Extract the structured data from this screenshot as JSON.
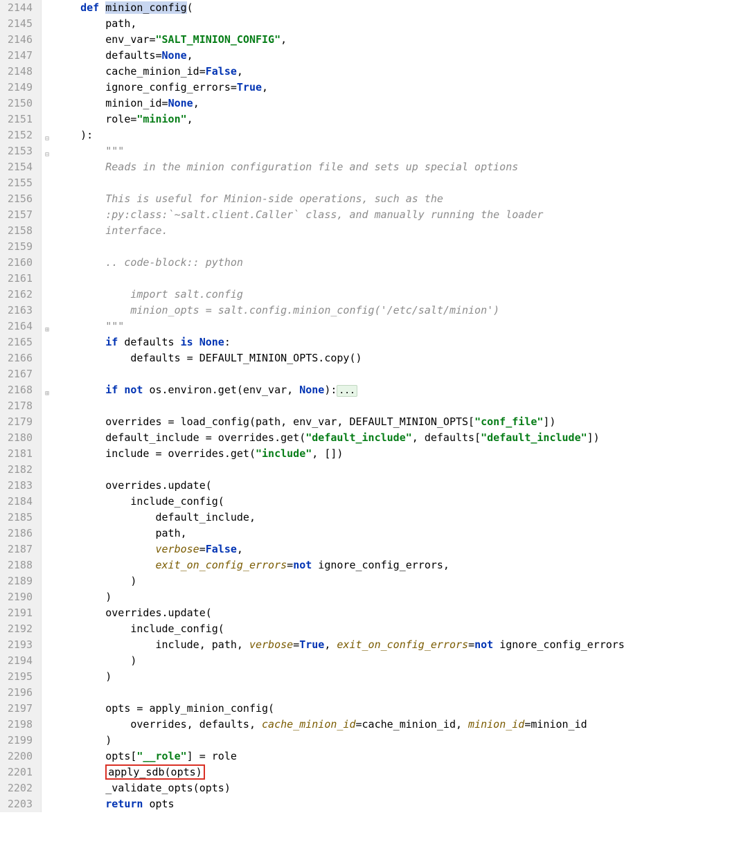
{
  "lines": [
    {
      "n": 2144,
      "segs": [
        {
          "t": "    ",
          "c": ""
        },
        {
          "t": "def",
          "c": "kw"
        },
        {
          "t": " ",
          "c": ""
        },
        {
          "t": "minion_config",
          "c": "selected"
        },
        {
          "t": "(",
          "c": ""
        }
      ]
    },
    {
      "n": 2145,
      "segs": [
        {
          "t": "        path,",
          "c": ""
        }
      ]
    },
    {
      "n": 2146,
      "segs": [
        {
          "t": "        env_var=",
          "c": ""
        },
        {
          "t": "\"SALT_MINION_CONFIG\"",
          "c": "str"
        },
        {
          "t": ",",
          "c": ""
        }
      ]
    },
    {
      "n": 2147,
      "segs": [
        {
          "t": "        defaults=",
          "c": ""
        },
        {
          "t": "None",
          "c": "const"
        },
        {
          "t": ",",
          "c": ""
        }
      ]
    },
    {
      "n": 2148,
      "segs": [
        {
          "t": "        cache_minion_id=",
          "c": ""
        },
        {
          "t": "False",
          "c": "const"
        },
        {
          "t": ",",
          "c": ""
        }
      ]
    },
    {
      "n": 2149,
      "segs": [
        {
          "t": "        ignore_config_errors=",
          "c": ""
        },
        {
          "t": "True",
          "c": "const"
        },
        {
          "t": ",",
          "c": ""
        }
      ]
    },
    {
      "n": 2150,
      "segs": [
        {
          "t": "        minion_id=",
          "c": ""
        },
        {
          "t": "None",
          "c": "const"
        },
        {
          "t": ",",
          "c": ""
        }
      ]
    },
    {
      "n": 2151,
      "segs": [
        {
          "t": "        role=",
          "c": ""
        },
        {
          "t": "\"minion\"",
          "c": "str"
        },
        {
          "t": ",",
          "c": ""
        }
      ]
    },
    {
      "n": 2152,
      "segs": [
        {
          "t": "    ):",
          "c": ""
        }
      ]
    },
    {
      "n": 2153,
      "segs": [
        {
          "t": "        ",
          "c": ""
        },
        {
          "t": "\"\"\"",
          "c": "comment"
        }
      ]
    },
    {
      "n": 2154,
      "segs": [
        {
          "t": "        Reads in the minion configuration file and sets up special options",
          "c": "comment"
        }
      ]
    },
    {
      "n": 2155,
      "segs": [
        {
          "t": "",
          "c": ""
        }
      ]
    },
    {
      "n": 2156,
      "segs": [
        {
          "t": "        This is useful for Minion-side operations, such as the",
          "c": "comment"
        }
      ]
    },
    {
      "n": 2157,
      "segs": [
        {
          "t": "        :py:class:`~salt.client.Caller` class, and manually running the loader",
          "c": "comment"
        }
      ]
    },
    {
      "n": 2158,
      "segs": [
        {
          "t": "        interface.",
          "c": "comment"
        }
      ]
    },
    {
      "n": 2159,
      "segs": [
        {
          "t": "",
          "c": ""
        }
      ]
    },
    {
      "n": 2160,
      "segs": [
        {
          "t": "        .. code-block:: python",
          "c": "comment"
        }
      ]
    },
    {
      "n": 2161,
      "segs": [
        {
          "t": "",
          "c": ""
        }
      ]
    },
    {
      "n": 2162,
      "segs": [
        {
          "t": "            import salt.config",
          "c": "comment"
        }
      ]
    },
    {
      "n": 2163,
      "segs": [
        {
          "t": "            minion_opts = salt.config.minion_config('/etc/salt/minion')",
          "c": "comment"
        }
      ]
    },
    {
      "n": 2164,
      "segs": [
        {
          "t": "        ",
          "c": ""
        },
        {
          "t": "\"\"\"",
          "c": "comment"
        }
      ]
    },
    {
      "n": 2165,
      "segs": [
        {
          "t": "        ",
          "c": ""
        },
        {
          "t": "if",
          "c": "kw"
        },
        {
          "t": " defaults ",
          "c": ""
        },
        {
          "t": "is",
          "c": "kw"
        },
        {
          "t": " ",
          "c": ""
        },
        {
          "t": "None",
          "c": "const"
        },
        {
          "t": ":",
          "c": ""
        }
      ]
    },
    {
      "n": 2166,
      "segs": [
        {
          "t": "            defaults = DEFAULT_MINION_OPTS.copy()",
          "c": ""
        }
      ]
    },
    {
      "n": 2167,
      "segs": [
        {
          "t": "",
          "c": ""
        }
      ]
    },
    {
      "n": 2168,
      "segs": [
        {
          "t": "        ",
          "c": ""
        },
        {
          "t": "if",
          "c": "kw"
        },
        {
          "t": " ",
          "c": ""
        },
        {
          "t": "not",
          "c": "kw"
        },
        {
          "t": " os.environ.get(env_var, ",
          "c": ""
        },
        {
          "t": "None",
          "c": "const"
        },
        {
          "t": "):",
          "c": ""
        },
        {
          "t": "...",
          "c": "folded"
        }
      ]
    },
    {
      "n": 2178,
      "segs": [
        {
          "t": "",
          "c": ""
        }
      ]
    },
    {
      "n": 2179,
      "segs": [
        {
          "t": "        overrides = load_config(path, env_var, DEFAULT_MINION_OPTS[",
          "c": ""
        },
        {
          "t": "\"conf_file\"",
          "c": "str"
        },
        {
          "t": "])",
          "c": ""
        }
      ]
    },
    {
      "n": 2180,
      "segs": [
        {
          "t": "        default_include = overrides.get(",
          "c": ""
        },
        {
          "t": "\"default_include\"",
          "c": "str"
        },
        {
          "t": ", defaults[",
          "c": ""
        },
        {
          "t": "\"default_include\"",
          "c": "str"
        },
        {
          "t": "])",
          "c": ""
        }
      ]
    },
    {
      "n": 2181,
      "segs": [
        {
          "t": "        include = overrides.get(",
          "c": ""
        },
        {
          "t": "\"include\"",
          "c": "str"
        },
        {
          "t": ", [])",
          "c": ""
        }
      ]
    },
    {
      "n": 2182,
      "segs": [
        {
          "t": "",
          "c": ""
        }
      ]
    },
    {
      "n": 2183,
      "segs": [
        {
          "t": "        overrides.update(",
          "c": ""
        }
      ]
    },
    {
      "n": 2184,
      "segs": [
        {
          "t": "            include_config(",
          "c": ""
        }
      ]
    },
    {
      "n": 2185,
      "segs": [
        {
          "t": "                default_include,",
          "c": ""
        }
      ]
    },
    {
      "n": 2186,
      "segs": [
        {
          "t": "                path,",
          "c": ""
        }
      ]
    },
    {
      "n": 2187,
      "segs": [
        {
          "t": "                ",
          "c": ""
        },
        {
          "t": "verbose",
          "c": "paramkw"
        },
        {
          "t": "=",
          "c": ""
        },
        {
          "t": "False",
          "c": "const"
        },
        {
          "t": ",",
          "c": ""
        }
      ]
    },
    {
      "n": 2188,
      "segs": [
        {
          "t": "                ",
          "c": ""
        },
        {
          "t": "exit_on_config_errors",
          "c": "paramkw"
        },
        {
          "t": "=",
          "c": ""
        },
        {
          "t": "not",
          "c": "kw"
        },
        {
          "t": " ignore_config_errors,",
          "c": ""
        }
      ]
    },
    {
      "n": 2189,
      "segs": [
        {
          "t": "            )",
          "c": ""
        }
      ]
    },
    {
      "n": 2190,
      "segs": [
        {
          "t": "        )",
          "c": ""
        }
      ]
    },
    {
      "n": 2191,
      "segs": [
        {
          "t": "        overrides.update(",
          "c": ""
        }
      ]
    },
    {
      "n": 2192,
      "segs": [
        {
          "t": "            include_config(",
          "c": ""
        }
      ]
    },
    {
      "n": 2193,
      "segs": [
        {
          "t": "                include, path, ",
          "c": ""
        },
        {
          "t": "verbose",
          "c": "paramkw"
        },
        {
          "t": "=",
          "c": ""
        },
        {
          "t": "True",
          "c": "const"
        },
        {
          "t": ", ",
          "c": ""
        },
        {
          "t": "exit_on_config_errors",
          "c": "paramkw"
        },
        {
          "t": "=",
          "c": ""
        },
        {
          "t": "not",
          "c": "kw"
        },
        {
          "t": " ignore_config_errors",
          "c": ""
        }
      ]
    },
    {
      "n": 2194,
      "segs": [
        {
          "t": "            )",
          "c": ""
        }
      ]
    },
    {
      "n": 2195,
      "segs": [
        {
          "t": "        )",
          "c": ""
        }
      ]
    },
    {
      "n": 2196,
      "segs": [
        {
          "t": "",
          "c": ""
        }
      ]
    },
    {
      "n": 2197,
      "segs": [
        {
          "t": "        opts = apply_minion_config(",
          "c": ""
        }
      ]
    },
    {
      "n": 2198,
      "segs": [
        {
          "t": "            overrides, defaults, ",
          "c": ""
        },
        {
          "t": "cache_minion_id",
          "c": "paramkw"
        },
        {
          "t": "=cache_minion_id, ",
          "c": ""
        },
        {
          "t": "minion_id",
          "c": "paramkw"
        },
        {
          "t": "=minion_id",
          "c": ""
        }
      ]
    },
    {
      "n": 2199,
      "segs": [
        {
          "t": "        )",
          "c": ""
        }
      ]
    },
    {
      "n": 2200,
      "segs": [
        {
          "t": "        opts[",
          "c": ""
        },
        {
          "t": "\"__role\"",
          "c": "str"
        },
        {
          "t": "] = role",
          "c": ""
        }
      ]
    },
    {
      "n": 2201,
      "segs": [
        {
          "t": "        ",
          "c": ""
        },
        {
          "t": "apply_sdb(opts)",
          "c": "redbox"
        }
      ]
    },
    {
      "n": 2202,
      "segs": [
        {
          "t": "        _validate_opts(opts)",
          "c": ""
        }
      ]
    },
    {
      "n": 2203,
      "segs": [
        {
          "t": "        ",
          "c": ""
        },
        {
          "t": "return",
          "c": "kw"
        },
        {
          "t": " opts",
          "c": ""
        }
      ]
    }
  ],
  "folds": {
    "2152": "⊟",
    "2153": "⊟",
    "2164": "⊞",
    "2168": "⊞"
  }
}
